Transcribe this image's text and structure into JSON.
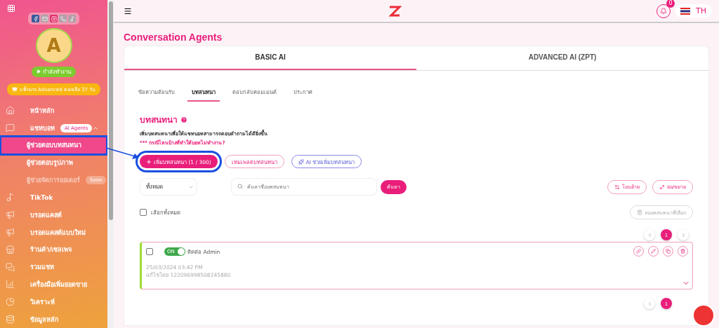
{
  "sidebar": {
    "social_icons": [
      {
        "kind": "facebook",
        "color": "#3b5998"
      },
      {
        "kind": "messages",
        "color": "#b0a0a8"
      },
      {
        "kind": "instagram",
        "color": "#e1306c"
      },
      {
        "kind": "whatsapp",
        "color": "#b0a0a8"
      },
      {
        "kind": "tiktok",
        "color": "#b0a0a8"
      }
    ],
    "avatar": "A",
    "status": "กำลังทำงาน",
    "package": "แพ็กเกจ Advanced คงเหลือ 37 วัน",
    "items": [
      {
        "kind": "home",
        "label": "หน้าหลัก",
        "selected": false
      },
      {
        "kind": "chat",
        "label": "แชทบอท",
        "badge": "AI Agents",
        "expanded": true,
        "selected": false,
        "children": [
          {
            "label": "ผู้ช่วยตอบบทสนทนา",
            "selected": true,
            "highlighted": true,
            "disabled": false
          },
          {
            "label": "ผู้ช่วยตอบรูปภาพ",
            "selected": false,
            "highlighted": false,
            "disabled": false
          },
          {
            "label": "ผู้ช่วยจัดการออเดอร์",
            "selected": false,
            "highlighted": false,
            "disabled": true,
            "badge": "Soon"
          }
        ]
      },
      {
        "kind": "tiktok",
        "label": "TikTok",
        "selected": false
      },
      {
        "kind": "megaphone",
        "label": "บรอดแคสต์",
        "selected": false
      },
      {
        "kind": "megaphone",
        "label": "บรอดแคสต์แบบใหม่",
        "selected": false
      },
      {
        "kind": "store",
        "label": "ร้านค้า/เซลเพจ",
        "selected": false
      },
      {
        "kind": "chats",
        "label": "รวมแชท",
        "selected": false
      },
      {
        "kind": "chart",
        "label": "เครื่องมือเพิ่มยอดขาย",
        "selected": false
      },
      {
        "kind": "analytics",
        "label": "วิเคราะห์",
        "selected": false
      },
      {
        "kind": "database",
        "label": "ข้อมูลหลัก",
        "selected": false
      }
    ]
  },
  "topbar": {
    "notifications": "0",
    "language": "TH"
  },
  "page_title": "Conversation Agents",
  "tabs": [
    {
      "label": "BASIC AI",
      "selected": true
    },
    {
      "label": "ADVANCED AI (ZPT)",
      "selected": false
    }
  ],
  "subtabs": [
    {
      "label": "ข้อความต้อนรับ",
      "selected": false
    },
    {
      "label": "บทสนทนา",
      "selected": true
    },
    {
      "label": "ตอบกลับคอมเมนต์",
      "selected": false
    },
    {
      "label": "ประกาศ",
      "selected": false
    }
  ],
  "section": {
    "title": "บทสนทนา",
    "description": "เพิ่มบทสนทนาเพื่อให้แชทบอทสามารถตอบคำถามได้ดียิ่งขึ้น",
    "help_link": "*** กรณีไหนบ้างที่ทำให้บอทไม่ทำงาน?"
  },
  "actions": [
    {
      "kind": "primary",
      "label": "เพิ่มบทสนทนา (1 / 300)",
      "highlighted": true
    },
    {
      "kind": "outline",
      "label": "เทมเพลตบทสนทนา",
      "highlighted": false
    },
    {
      "kind": "ai",
      "label": "AI ช่วยเพิ่มบทสนทนา",
      "highlighted": false
    }
  ],
  "filter": {
    "value": "ทั้งหมด",
    "search_placeholder": "ค้นหาชื่อบทสนทนา",
    "search_button": "ค้นหา",
    "move_button": "โอนย้าย",
    "expand_button": "ย่อ/ขยาย"
  },
  "select_all": {
    "label": "เลือกทั้งหมด",
    "checked": false
  },
  "delete_selected": {
    "label": "ลบบทสนทนาที่เลือก",
    "disabled": true
  },
  "pagination_top": [
    {
      "label": "1",
      "selected": true
    }
  ],
  "conversations": [
    {
      "checked": false,
      "on": true,
      "toggle_label": "ON",
      "name": "ติดต่อ Admin",
      "date": "25/03/2024 03:42 PM",
      "editor": "แก้ไขโดย 122096998508245880",
      "expanded": false
    }
  ],
  "pagination_bottom": [
    {
      "label": "1",
      "selected": true
    }
  ]
}
